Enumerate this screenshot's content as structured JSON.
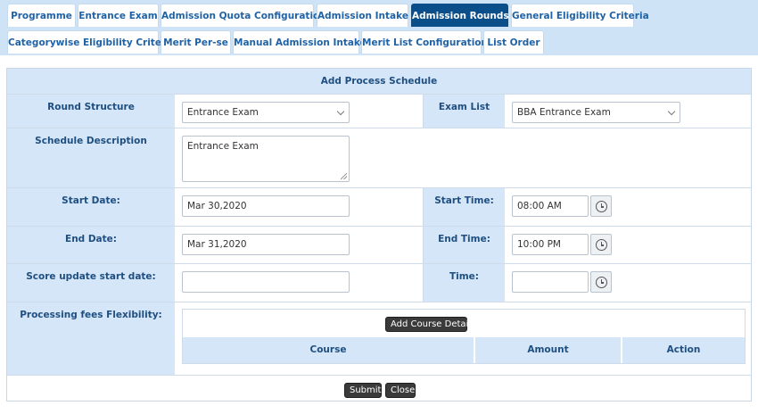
{
  "tabs": [
    {
      "label": "Programme"
    },
    {
      "label": "Entrance Exam"
    },
    {
      "label": "Admission Quota Configuration"
    },
    {
      "label": "Admission Intake"
    },
    {
      "label": "Admission Rounds",
      "active": true
    },
    {
      "label": "General Eligibility Criteria"
    },
    {
      "label": "Categorywise Eligibility Criteria"
    },
    {
      "label": "Merit Per-se"
    },
    {
      "label": "Manual Admission Intake"
    },
    {
      "label": "Merit List Configuration"
    },
    {
      "label": "List Order"
    }
  ],
  "panel": {
    "title": "Add Process Schedule"
  },
  "form": {
    "round_structure": {
      "label": "Round Structure",
      "value": "Entrance Exam"
    },
    "exam_list": {
      "label": "Exam List",
      "value": "BBA Entrance Exam"
    },
    "schedule_description": {
      "label": "Schedule Description",
      "value": "Entrance Exam"
    },
    "start_date": {
      "label": "Start Date:",
      "value": "Mar 30,2020"
    },
    "start_time": {
      "label": "Start Time:",
      "value": "08:00 AM"
    },
    "end_date": {
      "label": "End Date:",
      "value": "Mar 31,2020"
    },
    "end_time": {
      "label": "End Time:",
      "value": "10:00 PM"
    },
    "score_update_start_date": {
      "label": "Score update start date:",
      "value": ""
    },
    "score_time": {
      "label": "Time:",
      "value": ""
    },
    "processing_fees": {
      "label": "Processing fees Flexibility:"
    }
  },
  "course_table": {
    "add_button": "Add Course Details",
    "columns": [
      "Course",
      "Amount",
      "Action"
    ]
  },
  "actions": {
    "submit": "Submit",
    "close": "Close"
  },
  "icons": {
    "clock": "clock-icon",
    "dropdown": "chevron-down-icon",
    "resize": "resize-grip-icon"
  },
  "colors": {
    "accent": "#0b4f8a",
    "tab_bar": "#cfe3f7",
    "label_bg": "#d5e6f8",
    "label_text": "#1f4f80"
  }
}
